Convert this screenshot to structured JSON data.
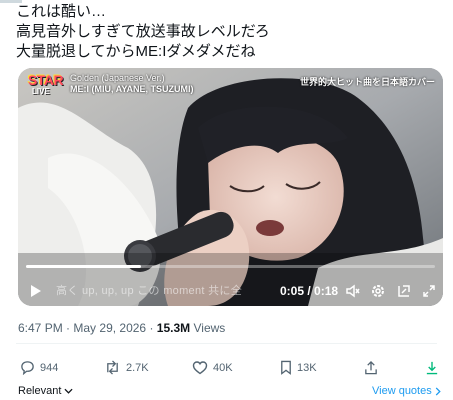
{
  "tweet": {
    "lines": [
      "これは酷い…",
      "高見音外しすぎて放送事故レベルだろ",
      "大量脱退してからME:Iダメダメだね"
    ]
  },
  "video": {
    "badge_main": "STAR",
    "badge_sub": "LIVE",
    "song_title": "Golden (Japanese Ver.)",
    "song_artist": "ME:I (MIU, AYANE, TSUZUMI)",
    "caption_right": "世界的大ヒット曲を日本語カバー",
    "subtitle": "高く up, up, up この moment 共に全",
    "time": "0:05 / 0:18",
    "progress": 0.28
  },
  "meta": {
    "time": "6:47 PM",
    "sep1": "·",
    "date": "May 29, 2026",
    "sep2": "·",
    "views": "15.3M",
    "views_label": "Views"
  },
  "actions": {
    "replies": "944",
    "reposts": "2.7K",
    "likes": "40K",
    "bookmarks": "13K"
  },
  "footer": {
    "relevant": "Relevant",
    "view_quotes": "View quotes"
  },
  "colors": {
    "accent": "#1d9bf0",
    "stats_green": "#00ba7c",
    "muted": "#536471"
  }
}
